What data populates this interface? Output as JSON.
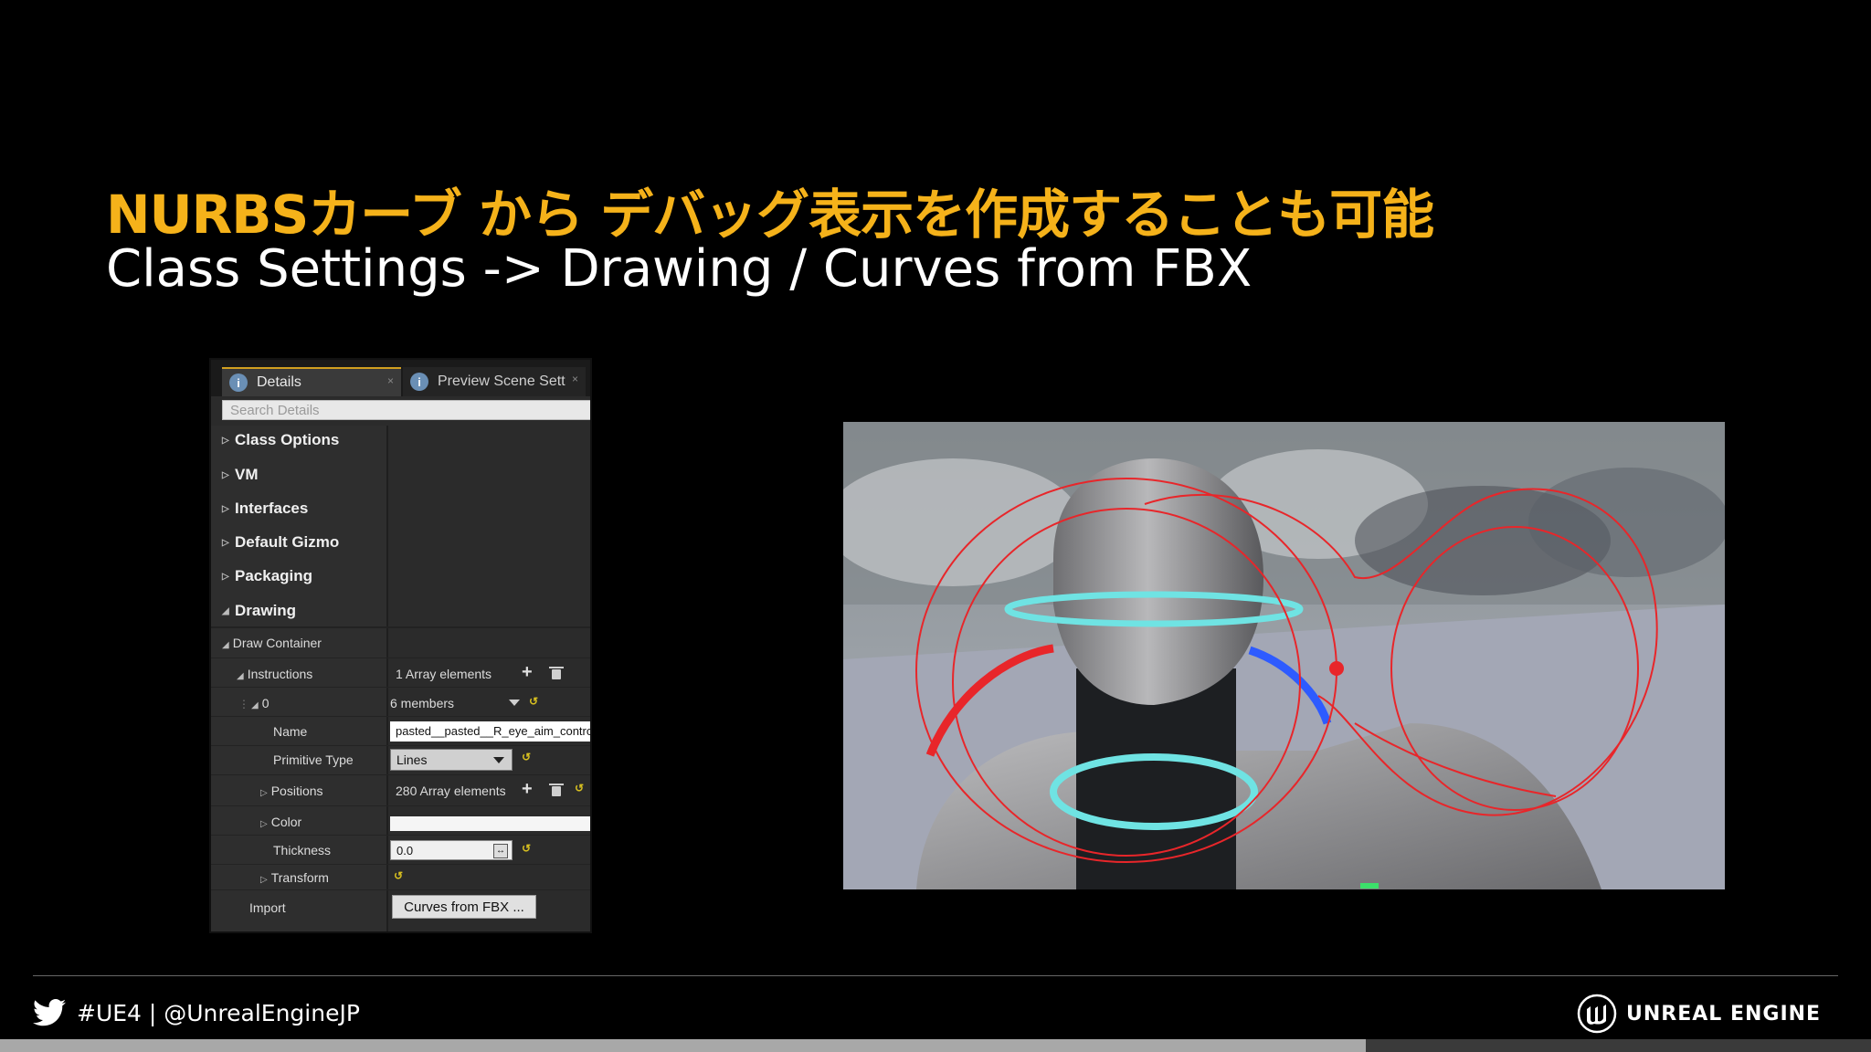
{
  "slide": {
    "title": "NURBSカーブ から デバッグ表示を作成することも可能",
    "subtitle": "Class Settings -> Drawing / Curves from FBX"
  },
  "panel": {
    "tabs": [
      {
        "label": "Details",
        "icon": "info-icon"
      },
      {
        "label": "Preview Scene Sett",
        "icon": "info-icon"
      }
    ],
    "search_placeholder": "Search Details",
    "categories": [
      "Class Options",
      "VM",
      "Interfaces",
      "Default Gizmo",
      "Packaging",
      "Drawing"
    ],
    "draw_container": "Draw Container",
    "instructions": {
      "label": "Instructions",
      "value": "1 Array elements"
    },
    "element": {
      "index": "0",
      "value": "6 members"
    },
    "name": {
      "label": "Name",
      "value": "pasted__pasted__R_eye_aim_contro"
    },
    "primitive_type": {
      "label": "Primitive Type",
      "value": "Lines"
    },
    "positions": {
      "label": "Positions",
      "value": "280 Array elements"
    },
    "color": {
      "label": "Color"
    },
    "thickness": {
      "label": "Thickness",
      "value": "0.0"
    },
    "transform": {
      "label": "Transform"
    },
    "import": {
      "label": "Import",
      "button": "Curves from FBX ..."
    }
  },
  "footer": {
    "social": "#UE4 | @UnrealEngineJP",
    "brand": "UNREAL ENGINE",
    "progress": 0.73
  },
  "colors": {
    "title": "#f5b21a",
    "curve_red": "#e8262a",
    "gizmo_cyan": "#6fe3e3",
    "gizmo_blue": "#2e5bff"
  }
}
